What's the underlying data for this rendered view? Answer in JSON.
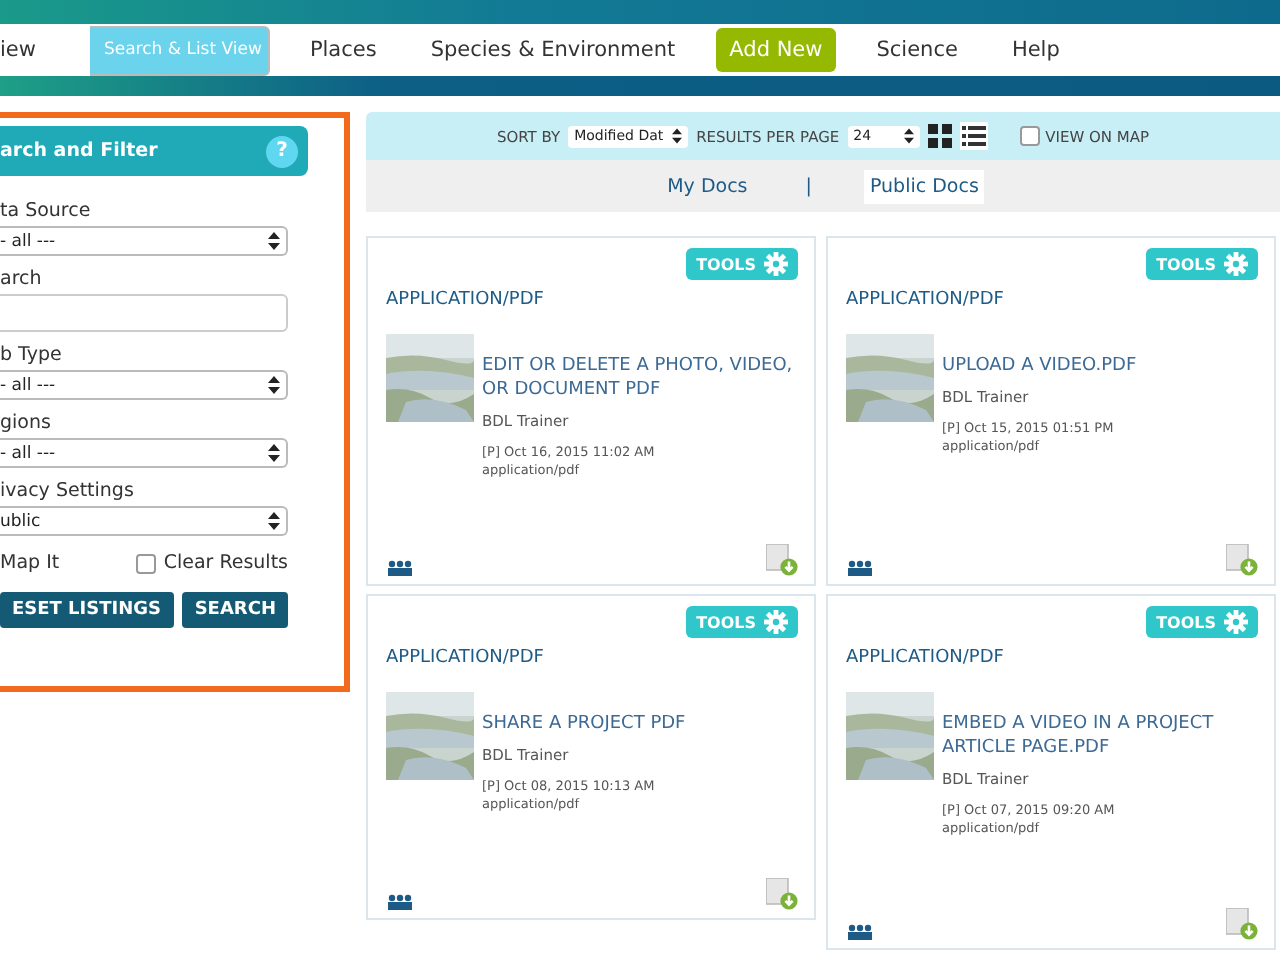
{
  "nav": [
    {
      "label": "iew",
      "kind": "link",
      "selected": false
    },
    {
      "label": "Search & List View",
      "kind": "link",
      "selected": true
    },
    {
      "label": "Places",
      "kind": "link",
      "selected": false
    },
    {
      "label": "Species & Environment",
      "kind": "link",
      "selected": false
    },
    {
      "label": "Add New",
      "kind": "action",
      "selected": false
    },
    {
      "label": "Science",
      "kind": "link",
      "selected": false
    },
    {
      "label": "Help",
      "kind": "link",
      "selected": false
    }
  ],
  "filter": {
    "title": "arch and Filter",
    "help": "?",
    "fields": [
      {
        "label": "ta Source",
        "kind": "select",
        "value": "- all ---"
      },
      {
        "label": "arch",
        "kind": "text"
      },
      {
        "label": "b Type",
        "kind": "select",
        "value": "- all ---"
      },
      {
        "label": "gions",
        "kind": "select",
        "value": "- all ---"
      },
      {
        "label": "ivacy Settings",
        "kind": "select",
        "value": "ublic"
      }
    ],
    "options": [
      {
        "label": "Map It"
      },
      {
        "label": "Clear Results",
        "checked": false
      }
    ],
    "reset_button": "ESET LISTINGS",
    "search_button": "SEARCH"
  },
  "toolbar": {
    "sort_label": "SORT BY",
    "sort_value": "Modified Dat",
    "per_page_label": "RESULTS PER PAGE",
    "per_page_value": "24",
    "view_on_map": {
      "label": "VIEW ON MAP",
      "checked": false
    }
  },
  "doc_tabs": [
    {
      "label": "My Docs",
      "selected": false
    },
    {
      "label": "Public Docs",
      "selected": true
    }
  ],
  "doc_tab_separator": "|",
  "cards": [
    {
      "tools": "TOOLS",
      "type": "APPLICATION/PDF",
      "title": "EDIT OR DELETE A PHOTO, VIDEO, OR DOCUMENT PDF",
      "author": "BDL Trainer",
      "date": "[P] Oct 16, 2015 11:02 AM",
      "mime": "application/pdf"
    },
    {
      "tools": "TOOLS",
      "type": "APPLICATION/PDF",
      "title": "UPLOAD A VIDEO.PDF",
      "author": "BDL Trainer",
      "date": "[P] Oct 15, 2015 01:51 PM",
      "mime": "application/pdf"
    },
    {
      "tools": "TOOLS",
      "type": "APPLICATION/PDF",
      "title": "SHARE A PROJECT PDF",
      "author": "BDL Trainer",
      "date": "[P] Oct 08, 2015 10:13 AM",
      "mime": "application/pdf"
    },
    {
      "tools": "TOOLS",
      "type": "APPLICATION/PDF",
      "title": "EMBED A VIDEO IN A PROJECT ARTICLE PAGE.PDF",
      "author": "BDL Trainer",
      "date": "[P] Oct 07, 2015 09:20 AM",
      "mime": "application/pdf"
    }
  ]
}
